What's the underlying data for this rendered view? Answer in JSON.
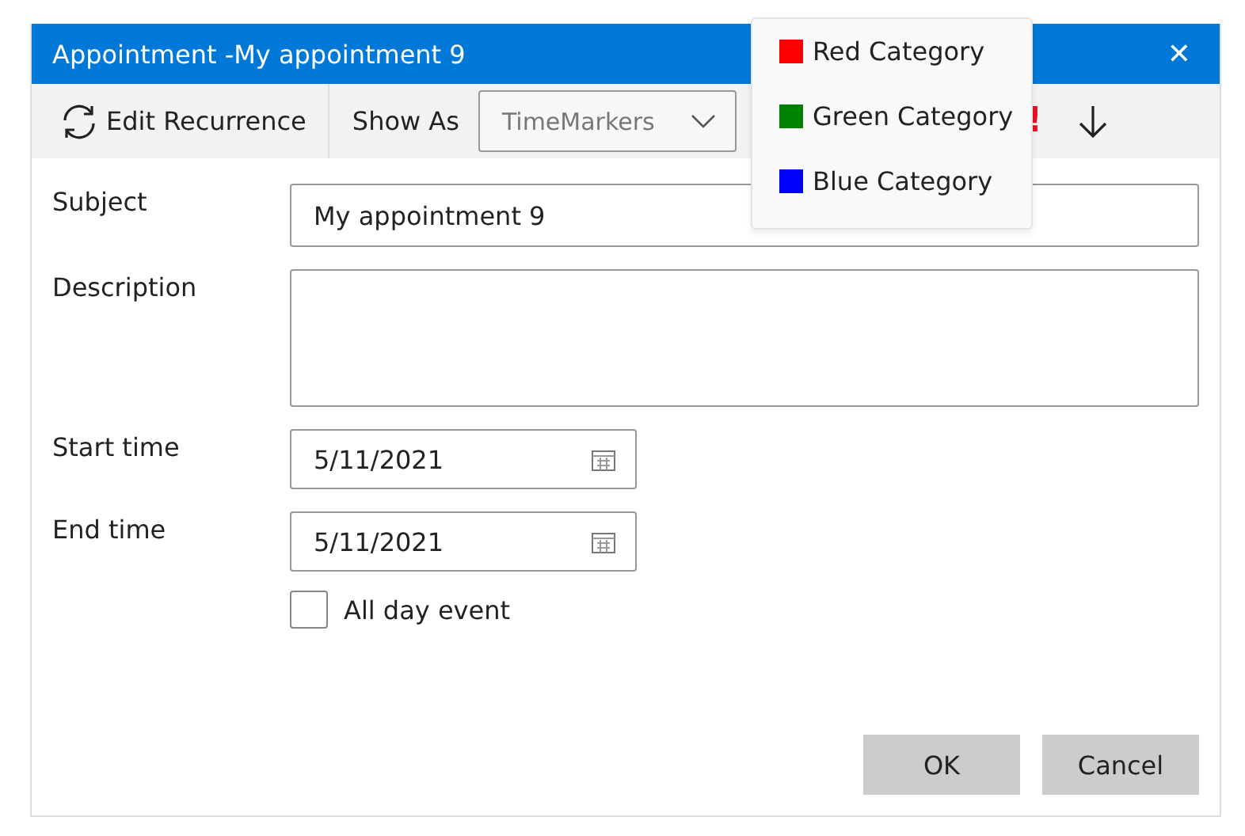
{
  "window": {
    "title": "Appointment -My appointment 9",
    "close": "✕"
  },
  "toolbar": {
    "edit_recurrence": "Edit Recurrence",
    "show_as_label": "Show As",
    "show_as_value": "TimeMarkers",
    "high_importance": "!"
  },
  "category_menu": [
    {
      "label": "Red Category",
      "color": "#ff0000"
    },
    {
      "label": "Green Category",
      "color": "#008000"
    },
    {
      "label": "Blue Category",
      "color": "#0000ff"
    }
  ],
  "form": {
    "subject_label": "Subject",
    "subject": "My appointment 9",
    "description_label": "Description",
    "start_label": "Start time",
    "start": "5/11/2021",
    "end_label": "End time",
    "end": "5/11/2021",
    "all_day_label": "All day event",
    "all_day": false
  },
  "buttons": [
    "OK",
    "Cancel"
  ]
}
